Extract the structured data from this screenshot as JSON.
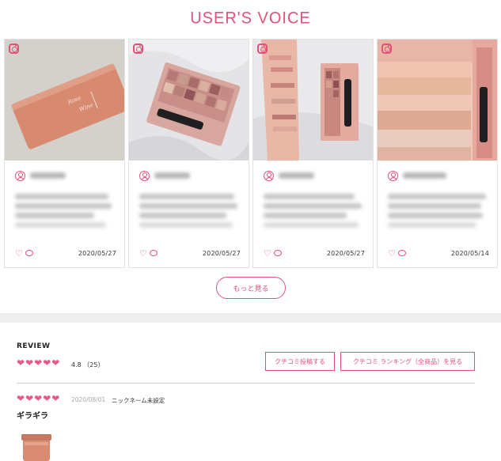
{
  "user_voice": {
    "title": "USER'S VOICE",
    "cards": [
      {
        "date": "2020/05/27"
      },
      {
        "date": "2020/05/27"
      },
      {
        "date": "2020/05/27"
      },
      {
        "date": "2020/05/14"
      }
    ],
    "more_label": "もっと見る"
  },
  "review": {
    "label": "REVIEW",
    "score": "4.8",
    "count": "（25）",
    "post_button": "クチコミ投稿する",
    "ranking_button": "クチコミ ランキング（全商品）を見る",
    "items": [
      {
        "date": "2020/08/01",
        "nickname": "ニックネーム未設定",
        "title": "ギラギラ"
      }
    ]
  },
  "colors": {
    "accent": "#e0527a",
    "star": "#e55a86"
  }
}
